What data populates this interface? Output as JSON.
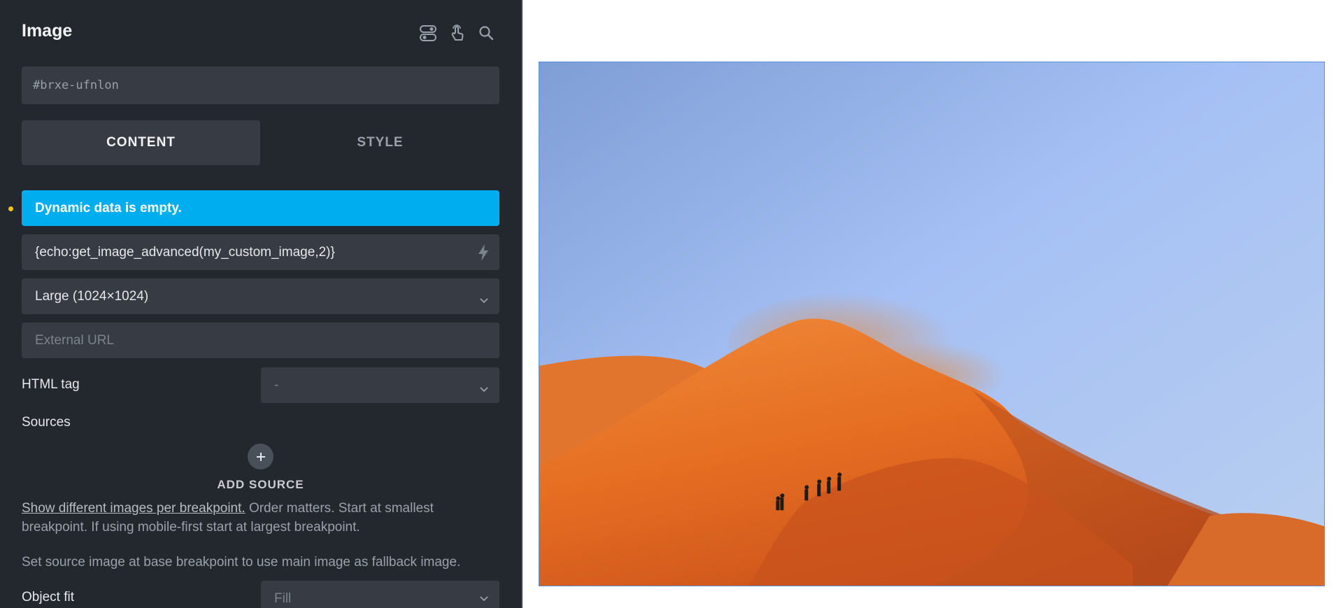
{
  "panel": {
    "title": "Image",
    "header_icons": [
      "toggle-icon",
      "touch-icon",
      "search-icon"
    ],
    "css_id_placeholder": "#brxe-ufnlon",
    "tabs": [
      {
        "label": "CONTENT",
        "active": true
      },
      {
        "label": "STYLE",
        "active": false
      }
    ],
    "notice": "Dynamic data is empty.",
    "dynamic_value": "{echo:get_image_advanced(my_custom_image,2)}",
    "size_select": "Large (1024×1024)",
    "external_url_placeholder": "External URL",
    "html_tag": {
      "label": "HTML tag",
      "value": "-"
    },
    "sources": {
      "label": "Sources",
      "add_label": "ADD SOURCE",
      "help_link": "Show different images per breakpoint.",
      "help_text": " Order matters. Start at smallest breakpoint. If using mobile-first start at largest breakpoint.",
      "help_text2": "Set source image at base breakpoint to use main image as fallback image."
    },
    "object_fit": {
      "label": "Object fit",
      "value": "Fill"
    }
  },
  "colors": {
    "panel_bg": "#23272e",
    "field_bg": "#363b44",
    "notice_bg": "#00aef0",
    "frame_border": "#5b8fd6"
  }
}
